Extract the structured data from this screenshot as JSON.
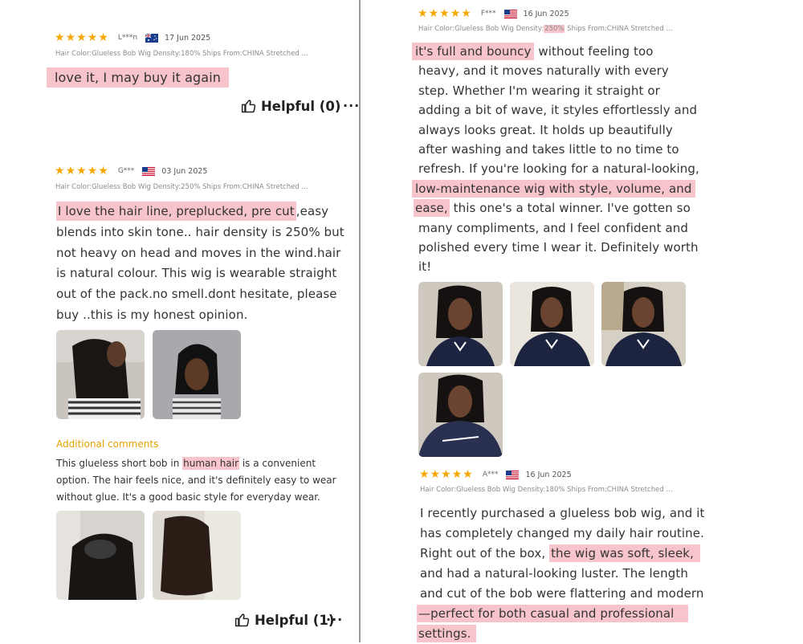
{
  "colors": {
    "star": "#f6a700",
    "highlight": "#f8c4cc",
    "additional": "#e8a000"
  },
  "left": {
    "review1": {
      "user": "L***n",
      "flag": "australia-flag-icon",
      "date": "17 Jun 2025",
      "meta": "Hair Color:Glueless Bob Wig Density:180% Ships From:CHINA Stretched ...",
      "text": "love it, I may buy it again",
      "helpful": "Helpful (0)"
    },
    "review2": {
      "user": "G***",
      "flag": "us-flag-icon",
      "date": "03 Jun 2025",
      "meta": "Hair Color:Glueless Bob Wig Density:250% Ships From:CHINA Stretched ...",
      "text_hl": "I love the hair line, preplucked, pre cut",
      "text_1": ",easy",
      "line2": "blends into skin tone.. hair density is 250% but",
      "line3": "not heavy on head and moves in the wind.hair",
      "line4": "is natural colour. This wig is wearable straight",
      "line5": "out of the pack.no smell.dont hesitate, please",
      "line6": "buy ..this is my honest opinion.",
      "additional_label": "Additional comments",
      "add_1": "This glueless short bob in ",
      "add_hl": "human hair",
      "add_2": " is a convenient",
      "add_line2": "option. The hair feels nice, and it's definitely easy to wear",
      "add_line3": "without glue. It's a good basic style for everyday wear.",
      "helpful": "Helpful (1)"
    }
  },
  "right": {
    "review3": {
      "user": "F***",
      "flag": "us-flag-icon",
      "date": "16 Jun 2025",
      "meta_1": "Hair Color:Glueless Bob Wig Density:",
      "meta_hl": "250%",
      "meta_2": " Ships From:CHINA Stretched ...",
      "l1_hl": "it's full and bouncy",
      "l1": " without feeling too",
      "l2": "heavy, and it moves naturally with every",
      "l3": "step. Whether I'm wearing it straight or",
      "l4": "adding a bit of wave, it styles effortlessly and",
      "l5": "always looks great. It holds up beautifully",
      "l6": "after washing and takes little to no time to",
      "l7": "refresh. If you're looking for a natural-looking,",
      "l8_hl": "low-maintenance wig with style, volume, and",
      "l9_hl": "ease,",
      "l9": " this one's a total winner. I've gotten so",
      "l10": "many compliments, and I feel confident and",
      "l11": "polished every time I wear it. Definitely worth",
      "l12": "it!"
    },
    "review4": {
      "user": "A***",
      "flag": "us-flag-icon",
      "date": "16 Jun 2025",
      "meta": "Hair Color:Glueless Bob Wig Density:180% Ships From:CHINA Stretched ...",
      "l1": "I recently purchased a glueless bob wig, and it",
      "l2": "has completely changed my daily hair routine.",
      "l3": "Right out of the box, ",
      "l3_hl": "the wig was soft, sleek,",
      "l4": "and had a natural-looking luster. The length",
      "l5": "and cut of the bob were flattering and modern",
      "l6_hl": "—perfect for both casual and professional",
      "l7_hl": "settings."
    }
  }
}
